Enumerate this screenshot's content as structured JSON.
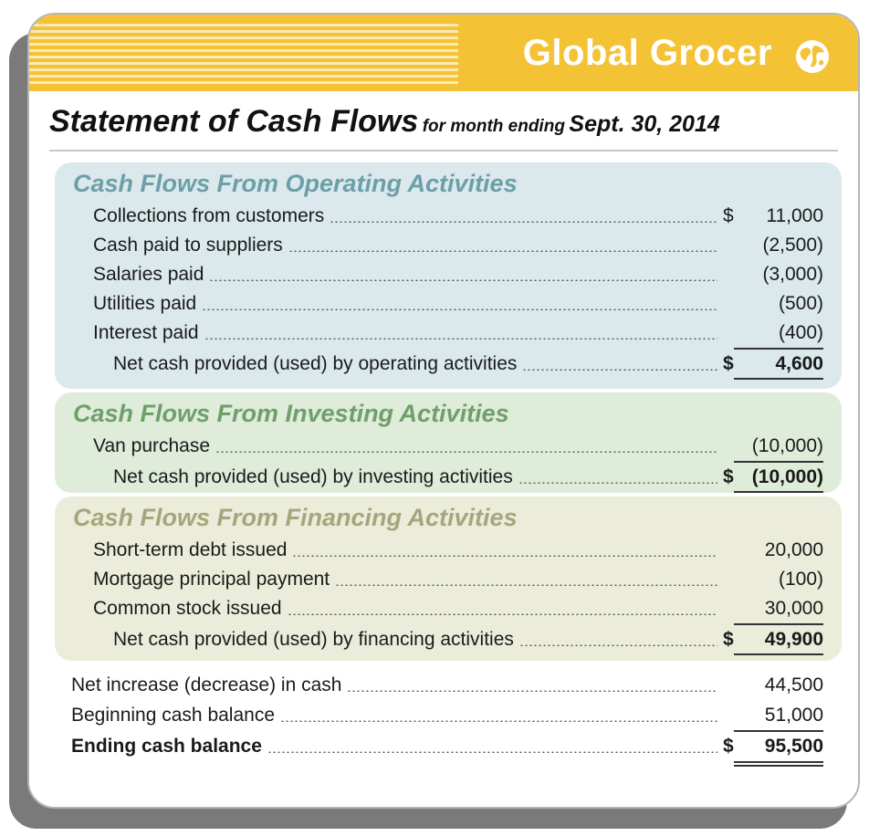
{
  "header": {
    "brand": "Global Grocer",
    "title": "Statement of Cash Flows",
    "subtitle": "for month ending",
    "date": "Sept. 30, 2014"
  },
  "operating": {
    "title": "Cash Flows From Operating Activities",
    "rows": [
      {
        "label": "Collections from customers",
        "currency": "$",
        "amount": "11,000"
      },
      {
        "label": "Cash paid to suppliers",
        "currency": "",
        "amount": "(2,500)"
      },
      {
        "label": "Salaries paid",
        "currency": "",
        "amount": "(3,000)"
      },
      {
        "label": "Utilities paid",
        "currency": "",
        "amount": "(500)"
      },
      {
        "label": "Interest paid",
        "currency": "",
        "amount": "(400)"
      }
    ],
    "net": {
      "label": "Net cash provided (used) by operating activities",
      "currency": "$",
      "amount": "4,600"
    }
  },
  "investing": {
    "title": "Cash Flows From Investing Activities",
    "rows": [
      {
        "label": "Van purchase",
        "currency": "",
        "amount": "(10,000)"
      }
    ],
    "net": {
      "label": "Net cash provided (used) by investing activities",
      "currency": "$",
      "amount": "(10,000)"
    }
  },
  "financing": {
    "title": "Cash Flows From Financing Activities",
    "rows": [
      {
        "label": "Short-term debt issued",
        "currency": "",
        "amount": "20,000"
      },
      {
        "label": "Mortgage principal payment",
        "currency": "",
        "amount": "(100)"
      },
      {
        "label": "Common stock issued",
        "currency": "",
        "amount": "30,000"
      }
    ],
    "net": {
      "label": "Net cash provided (used) by financing activities",
      "currency": "$",
      "amount": "49,900"
    }
  },
  "summary": [
    {
      "label": "Net increase (decrease) in cash",
      "currency": "",
      "amount": "44,500"
    },
    {
      "label": "Beginning cash balance",
      "currency": "",
      "amount": "51,000"
    },
    {
      "label": "Ending cash balance",
      "currency": "$",
      "amount": "95,500"
    }
  ],
  "colors": {
    "banner": "#f4c235",
    "operating_bg": "#dbe9ec",
    "investing_bg": "#deecd9",
    "financing_bg": "#ebedda",
    "operating_title": "#6c9fa9",
    "investing_title": "#6f9f6a",
    "financing_title": "#a6a57c"
  },
  "icons": {
    "brand_logo": "globe-icon"
  }
}
